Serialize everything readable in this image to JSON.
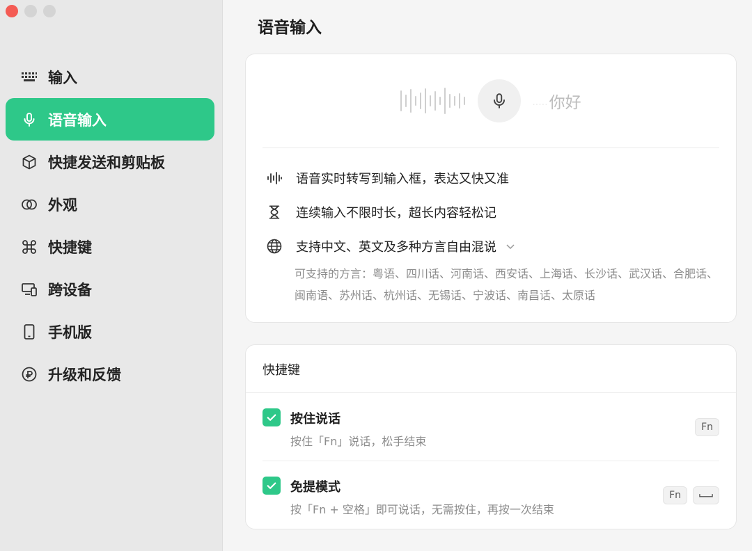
{
  "window": {
    "title": "语音输入"
  },
  "sidebar": {
    "items": [
      {
        "label": "输入",
        "icon": "keyboard-icon",
        "active": false
      },
      {
        "label": "语音输入",
        "icon": "microphone-icon",
        "active": true
      },
      {
        "label": "快捷发送和剪贴板",
        "icon": "cube-icon",
        "active": false
      },
      {
        "label": "外观",
        "icon": "rings-icon",
        "active": false
      },
      {
        "label": "快捷键",
        "icon": "command-icon",
        "active": false
      },
      {
        "label": "跨设备",
        "icon": "devices-icon",
        "active": false
      },
      {
        "label": "手机版",
        "icon": "phone-icon",
        "active": false
      },
      {
        "label": "升级和反馈",
        "icon": "update-icon",
        "active": false
      }
    ]
  },
  "main": {
    "title": "语音输入",
    "demo": {
      "hello_text": "你好"
    },
    "features": [
      {
        "icon": "waveform-icon",
        "text": "语音实时转写到输入框，表达又快又准"
      },
      {
        "icon": "hourglass-icon",
        "text": "连续输入不限时长，超长内容轻松记"
      },
      {
        "icon": "globe-icon",
        "text": "支持中文、英文及多种方言自由混说"
      }
    ],
    "dialects_text": "可支持的方言：粤语、四川话、河南话、西安话、上海话、长沙话、武汉话、合肥话、闽南语、苏州话、杭州话、无锡话、宁波话、南昌话、太原话",
    "shortcuts": {
      "title": "快捷键",
      "rows": [
        {
          "title": "按住说话",
          "desc": "按住「Fn」说话，松手结束",
          "checked": true,
          "keys": [
            "Fn"
          ]
        },
        {
          "title": "免提模式",
          "desc": "按「Fn + 空格」即可说话，无需按住，再按一次结束",
          "checked": true,
          "keys": [
            "Fn",
            "space"
          ]
        }
      ]
    }
  },
  "colors": {
    "accent": "#2ec889",
    "close": "#f45b54"
  }
}
